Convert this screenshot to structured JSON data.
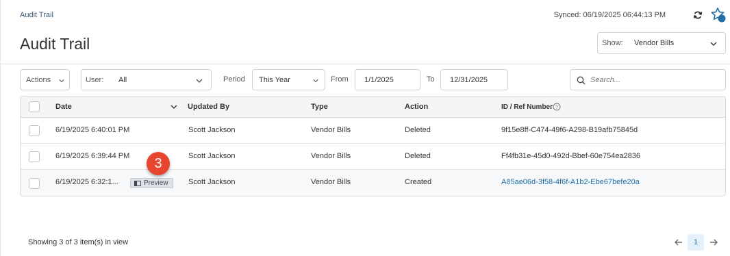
{
  "header": {
    "breadcrumb": "Audit Trail",
    "synced": "Synced: 06/19/2025 06:44:13 PM",
    "title": "Audit Trail",
    "show_label": "Show:",
    "show_value": "Vendor Bills"
  },
  "filters": {
    "actions_label": "Actions",
    "user_label": "User:",
    "user_value": "All",
    "period_label": "Period",
    "period_value": "This Year",
    "from_label": "From",
    "from_value": "1/1/2025",
    "to_label": "To",
    "to_value": "12/31/2025",
    "search_placeholder": "Search..."
  },
  "table": {
    "columns": [
      "Date",
      "Updated By",
      "Type",
      "Action",
      "ID / Ref Number"
    ],
    "rows": [
      {
        "date": "6/19/2025 6:40:01 PM",
        "updated_by": "Scott Jackson",
        "type": "Vendor Bills",
        "action": "Deleted",
        "ref": "9f15e8ff-C474-49f6-A298-B19afb75845d"
      },
      {
        "date": "6/19/2025 6:39:44 PM",
        "updated_by": "Scott Jackson",
        "type": "Vendor Bills",
        "action": "Deleted",
        "ref": "Ff4fb31e-45d0-492d-Bbef-60e754ea2836"
      },
      {
        "date": "6/19/2025 6:32:1...",
        "updated_by": "Scott Jackson",
        "type": "Vendor Bills",
        "action": "Created",
        "ref": "A85ae06d-3f58-4f6f-A1b2-Ebe67befe20a",
        "preview_label": "Preview"
      }
    ]
  },
  "callout": {
    "step": "3"
  },
  "footer": {
    "showing": "Showing 3 of 3 item(s) in view",
    "current_page": "1"
  },
  "colors": {
    "accent": "#1f6fa5",
    "callout": "#e8452e"
  },
  "icons": [
    "refresh-icon",
    "star-icon",
    "chevron-down-icon",
    "search-icon",
    "help-icon",
    "preview-icon",
    "arrow-left-icon",
    "arrow-right-icon"
  ]
}
